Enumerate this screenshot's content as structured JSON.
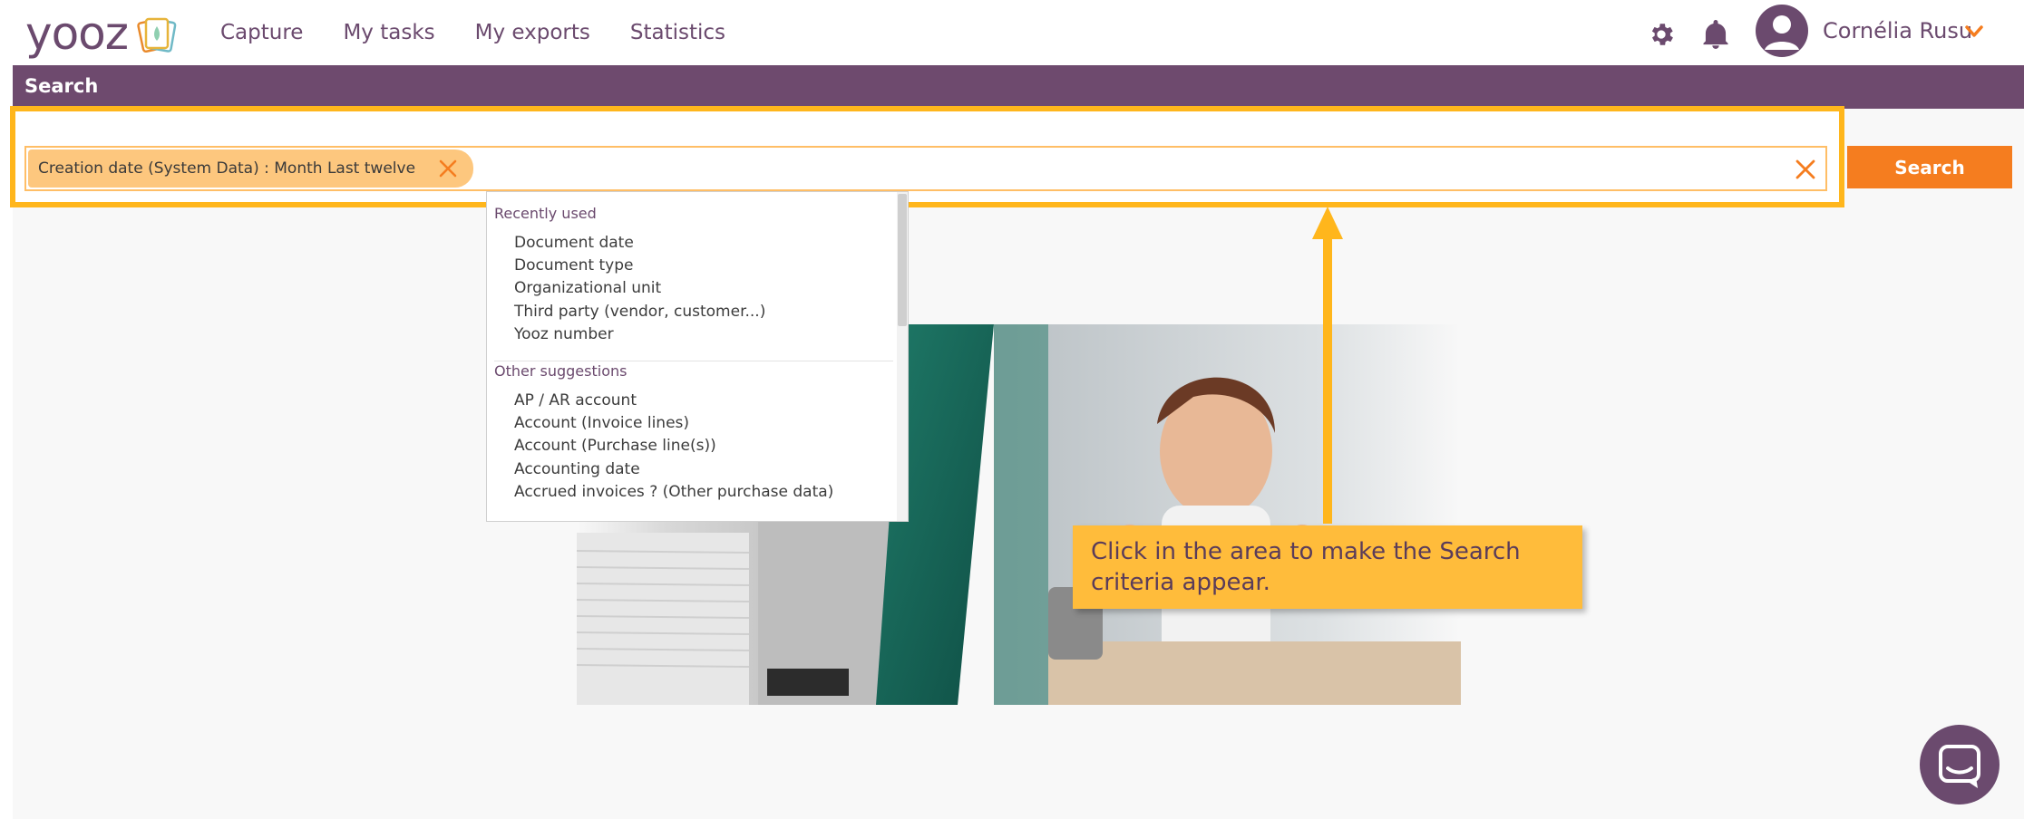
{
  "app": {
    "logo_text": "yooz",
    "colors": {
      "brand": "#6b4a6e",
      "accent": "#f57d1f",
      "highlight": "#ffb61c",
      "chip": "#fdc77e"
    }
  },
  "nav": {
    "links": [
      "Capture",
      "My tasks",
      "My exports",
      "Statistics"
    ],
    "icons": [
      "gear-icon",
      "bell-icon",
      "user-avatar-icon",
      "chevron-down-icon"
    ],
    "user_name": "Cornélia Rusu"
  },
  "search_header": {
    "title": "Search"
  },
  "search": {
    "chip_label": "Creation date (System Data) : Month Last twelve",
    "button_label": "Search"
  },
  "dropdown": {
    "recent_title": "Recently used",
    "recent_items": [
      "Document date",
      "Document type",
      "Organizational unit",
      "Third party (vendor, customer...)",
      "Yooz number"
    ],
    "other_title": "Other suggestions",
    "other_items": [
      "AP / AR account",
      "Account (Invoice lines)",
      "Account (Purchase line(s))",
      "Accounting date",
      "Accrued invoices ? (Other purchase data)"
    ]
  },
  "tooltip": {
    "text": "Click in the area to make the Search criteria appear."
  }
}
